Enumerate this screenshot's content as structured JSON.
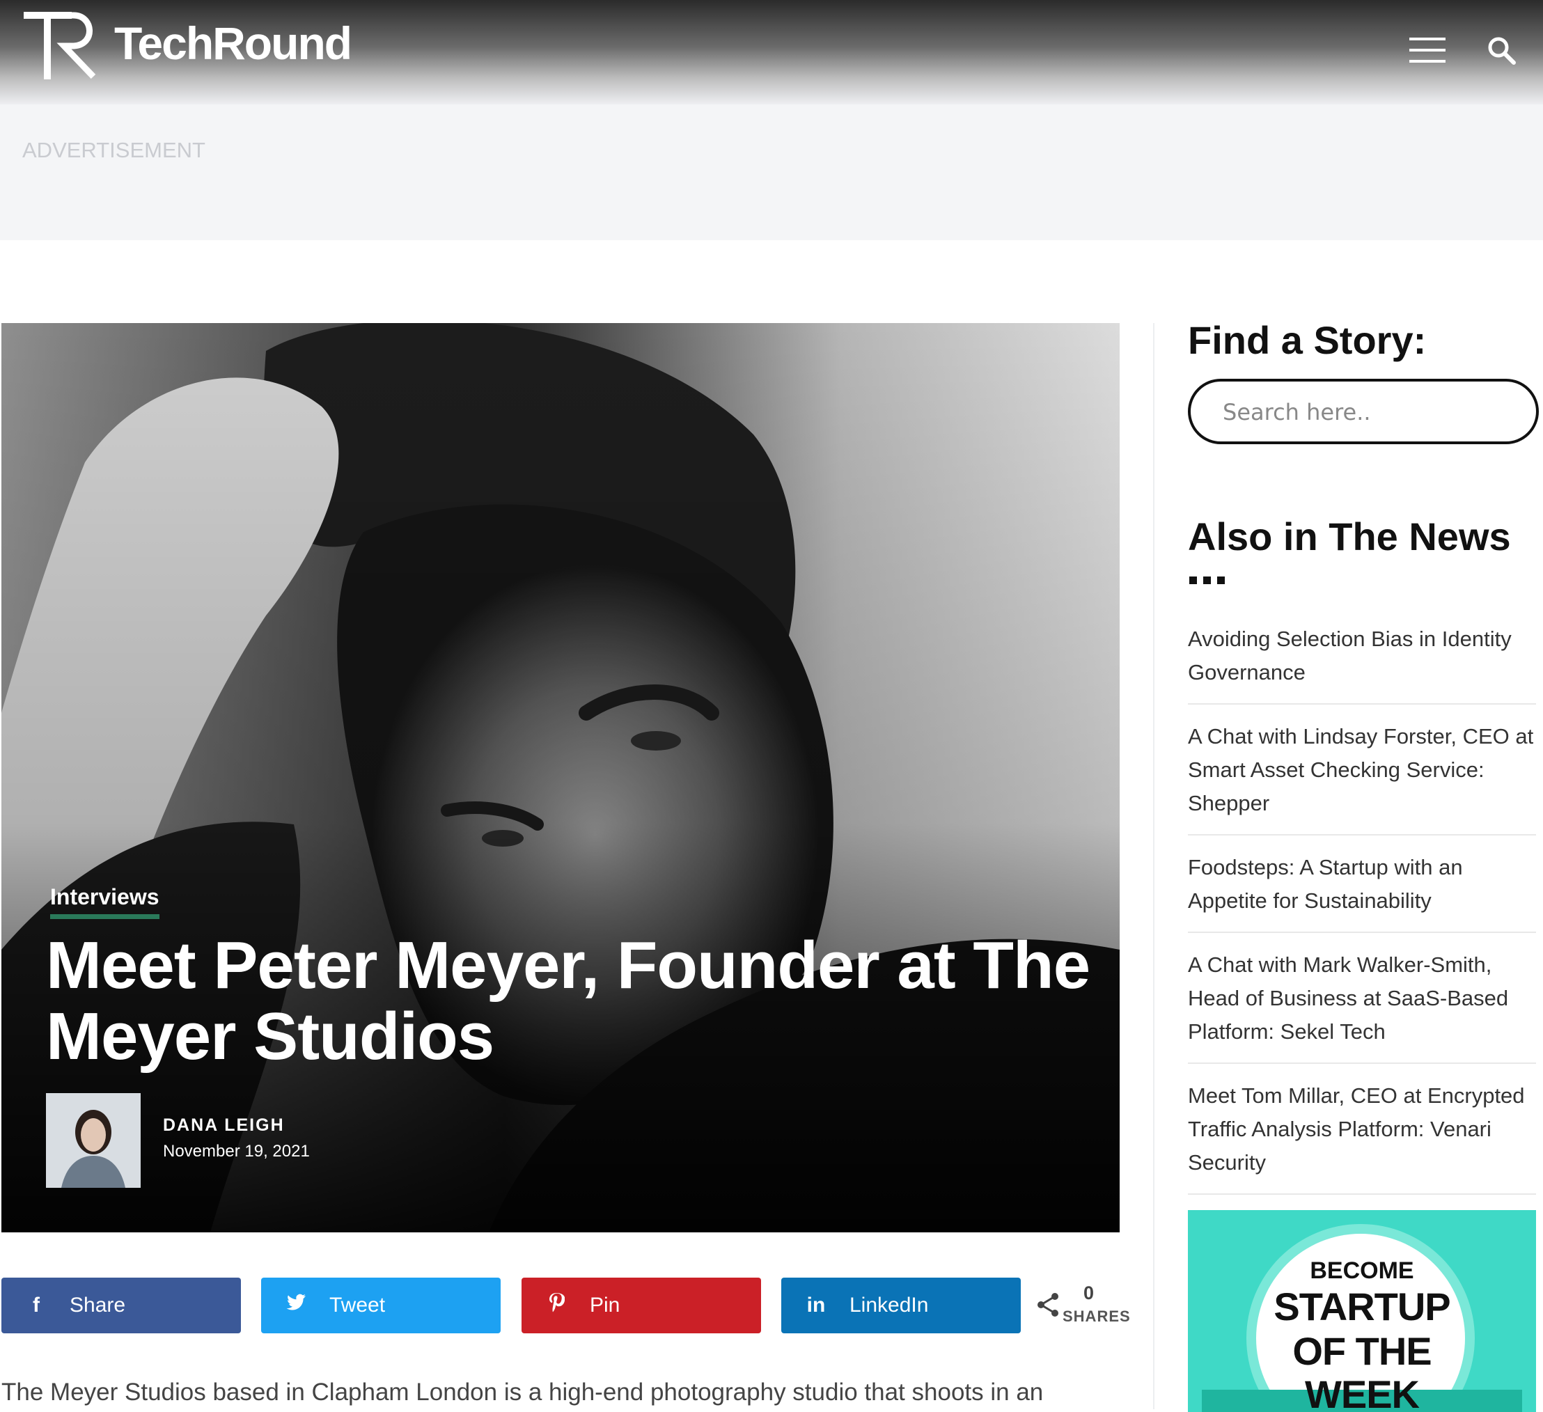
{
  "header": {
    "brand_name": "TechRound"
  },
  "ad": {
    "label": "ADVERTISEMENT"
  },
  "article": {
    "category": "Interviews",
    "headline": "Meet Peter Meyer, Founder at The Meyer Studios",
    "author": "DANA LEIGH",
    "date": "November 19, 2021",
    "intro": "The Meyer Studios based in Clapham London is a high-end photography studio that shoots in an"
  },
  "share_bar": {
    "buttons": [
      {
        "label": "Share",
        "icon": "facebook-icon",
        "color": "#3b5998"
      },
      {
        "label": "Tweet",
        "icon": "twitter-icon",
        "color": "#1da1f2"
      },
      {
        "label": "Pin",
        "icon": "pinterest-icon",
        "color": "#cb2027"
      },
      {
        "label": "LinkedIn",
        "icon": "linkedin-icon",
        "color": "#0a73b6"
      }
    ],
    "count": "0",
    "count_label": "SHARES"
  },
  "sidebar": {
    "find_title": "Find a Story:",
    "search_placeholder": "Search here..",
    "news_title": "Also in The News",
    "news_items": [
      {
        "title": "Avoiding Selection Bias in Identity Governance"
      },
      {
        "title": "A Chat with Lindsay Forster, CEO at Smart Asset Checking Service: Shepper"
      },
      {
        "title": "Foodsteps: A Startup with an Appetite for Sustainability"
      },
      {
        "title": "A Chat with Mark Walker-Smith, Head of Business at SaaS-Based Platform: Sekel Tech"
      },
      {
        "title": "Meet Tom Millar, CEO at Encrypted Traffic Analysis Platform: Venari Security"
      }
    ],
    "promo": {
      "line1": "BECOME",
      "line2": "STARTUP",
      "line3": "OF THE",
      "line4": "WEEK"
    }
  },
  "colors": {
    "category_underline": "#2a7a5a",
    "promo_background": "#3fd9c6"
  }
}
